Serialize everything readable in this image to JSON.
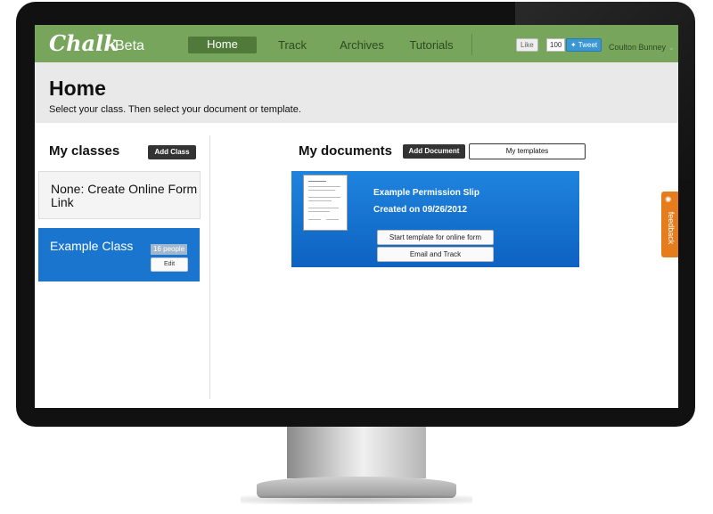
{
  "app": {
    "logo": "Chalk",
    "logo_suffix": "Beta"
  },
  "nav": {
    "items": [
      {
        "label": "Home",
        "active": true
      },
      {
        "label": "Track",
        "active": false
      },
      {
        "label": "Archives",
        "active": false
      },
      {
        "label": "Tutorials",
        "active": false
      }
    ]
  },
  "social": {
    "like_label": "Like",
    "like_count": "100",
    "tweet_label": "Tweet"
  },
  "user": {
    "name": "Coulton Bunney"
  },
  "page": {
    "title": "Home",
    "subtitle": "Select your class. Then select your document or template."
  },
  "classes": {
    "title": "My classes",
    "add_label": "Add Class",
    "items": [
      {
        "label": "None: Create Online Form Link",
        "active": false
      },
      {
        "label": "Example Class",
        "active": true,
        "badge": "16 people",
        "edit_label": "Edit"
      }
    ]
  },
  "documents": {
    "title": "My documents",
    "add_label": "Add Document",
    "templates_label": "My templates",
    "items": [
      {
        "name": "Example Permission Slip",
        "created": "Created on 09/26/2012",
        "start_label": "Start template for online form",
        "email_label": "Email and Track"
      }
    ]
  },
  "feedback": {
    "label": "feedback",
    "icon": "lightbulb-icon"
  },
  "colors": {
    "header_green": "#76a55b",
    "active_blue": "#1a75cf",
    "feedback_orange": "#e57d1c"
  }
}
